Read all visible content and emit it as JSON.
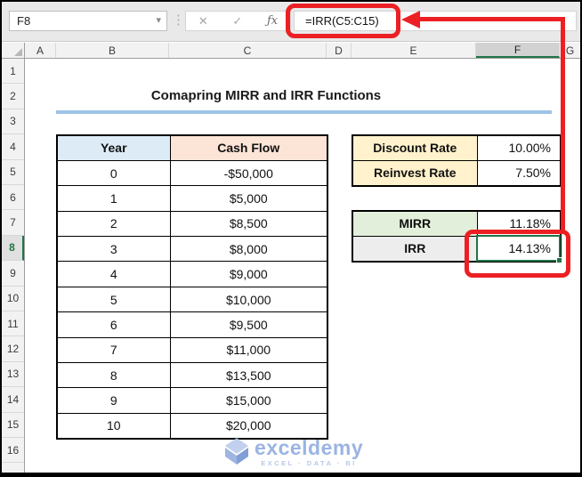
{
  "formula_bar": {
    "name_box": "F8",
    "dropdown_icon": "▾",
    "separator": "⋮",
    "cancel_icon": "✕",
    "enter_icon": "✓",
    "fx_label": "ƒx",
    "formula": "=IRR(C5:C15)"
  },
  "grid": {
    "column_headers": [
      "A",
      "B",
      "C",
      "D",
      "E",
      "F",
      "G"
    ],
    "selected_column": "F",
    "row_headers": [
      "1",
      "2",
      "3",
      "4",
      "5",
      "6",
      "7",
      "8",
      "9",
      "10",
      "11",
      "12",
      "13",
      "14",
      "15",
      "16"
    ],
    "selected_row": "8"
  },
  "sheet": {
    "title": "Comapring MIRR and IRR Functions",
    "cashflow_table": {
      "headers": [
        "Year",
        "Cash Flow"
      ],
      "rows": [
        [
          "0",
          "-$50,000"
        ],
        [
          "1",
          "$5,000"
        ],
        [
          "2",
          "$8,500"
        ],
        [
          "3",
          "$8,000"
        ],
        [
          "4",
          "$9,000"
        ],
        [
          "5",
          "$10,000"
        ],
        [
          "6",
          "$9,500"
        ],
        [
          "7",
          "$11,000"
        ],
        [
          "8",
          "$13,500"
        ],
        [
          "9",
          "$15,000"
        ],
        [
          "10",
          "$20,000"
        ]
      ]
    },
    "rates_table": {
      "rows": [
        [
          "Discount Rate",
          "10.00%"
        ],
        [
          "Reinvest Rate",
          "7.50%"
        ]
      ]
    },
    "results_table": {
      "rows": [
        [
          "MIRR",
          "11.18%"
        ],
        [
          "IRR",
          "14.13%"
        ]
      ]
    }
  },
  "watermark": {
    "name": "exceldemy",
    "tagline": "EXCEL · DATA · BI"
  },
  "colors": {
    "accent_green": "#217346",
    "annotation_red": "#ec2024",
    "title_underline_blue": "#9dc3e6",
    "year_header_bg": "#ddebf7",
    "cashflow_header_bg": "#fce4d6",
    "rate_label_bg": "#fff2cc",
    "mirr_label_bg": "#e2efda",
    "irr_label_bg": "#ededed"
  }
}
